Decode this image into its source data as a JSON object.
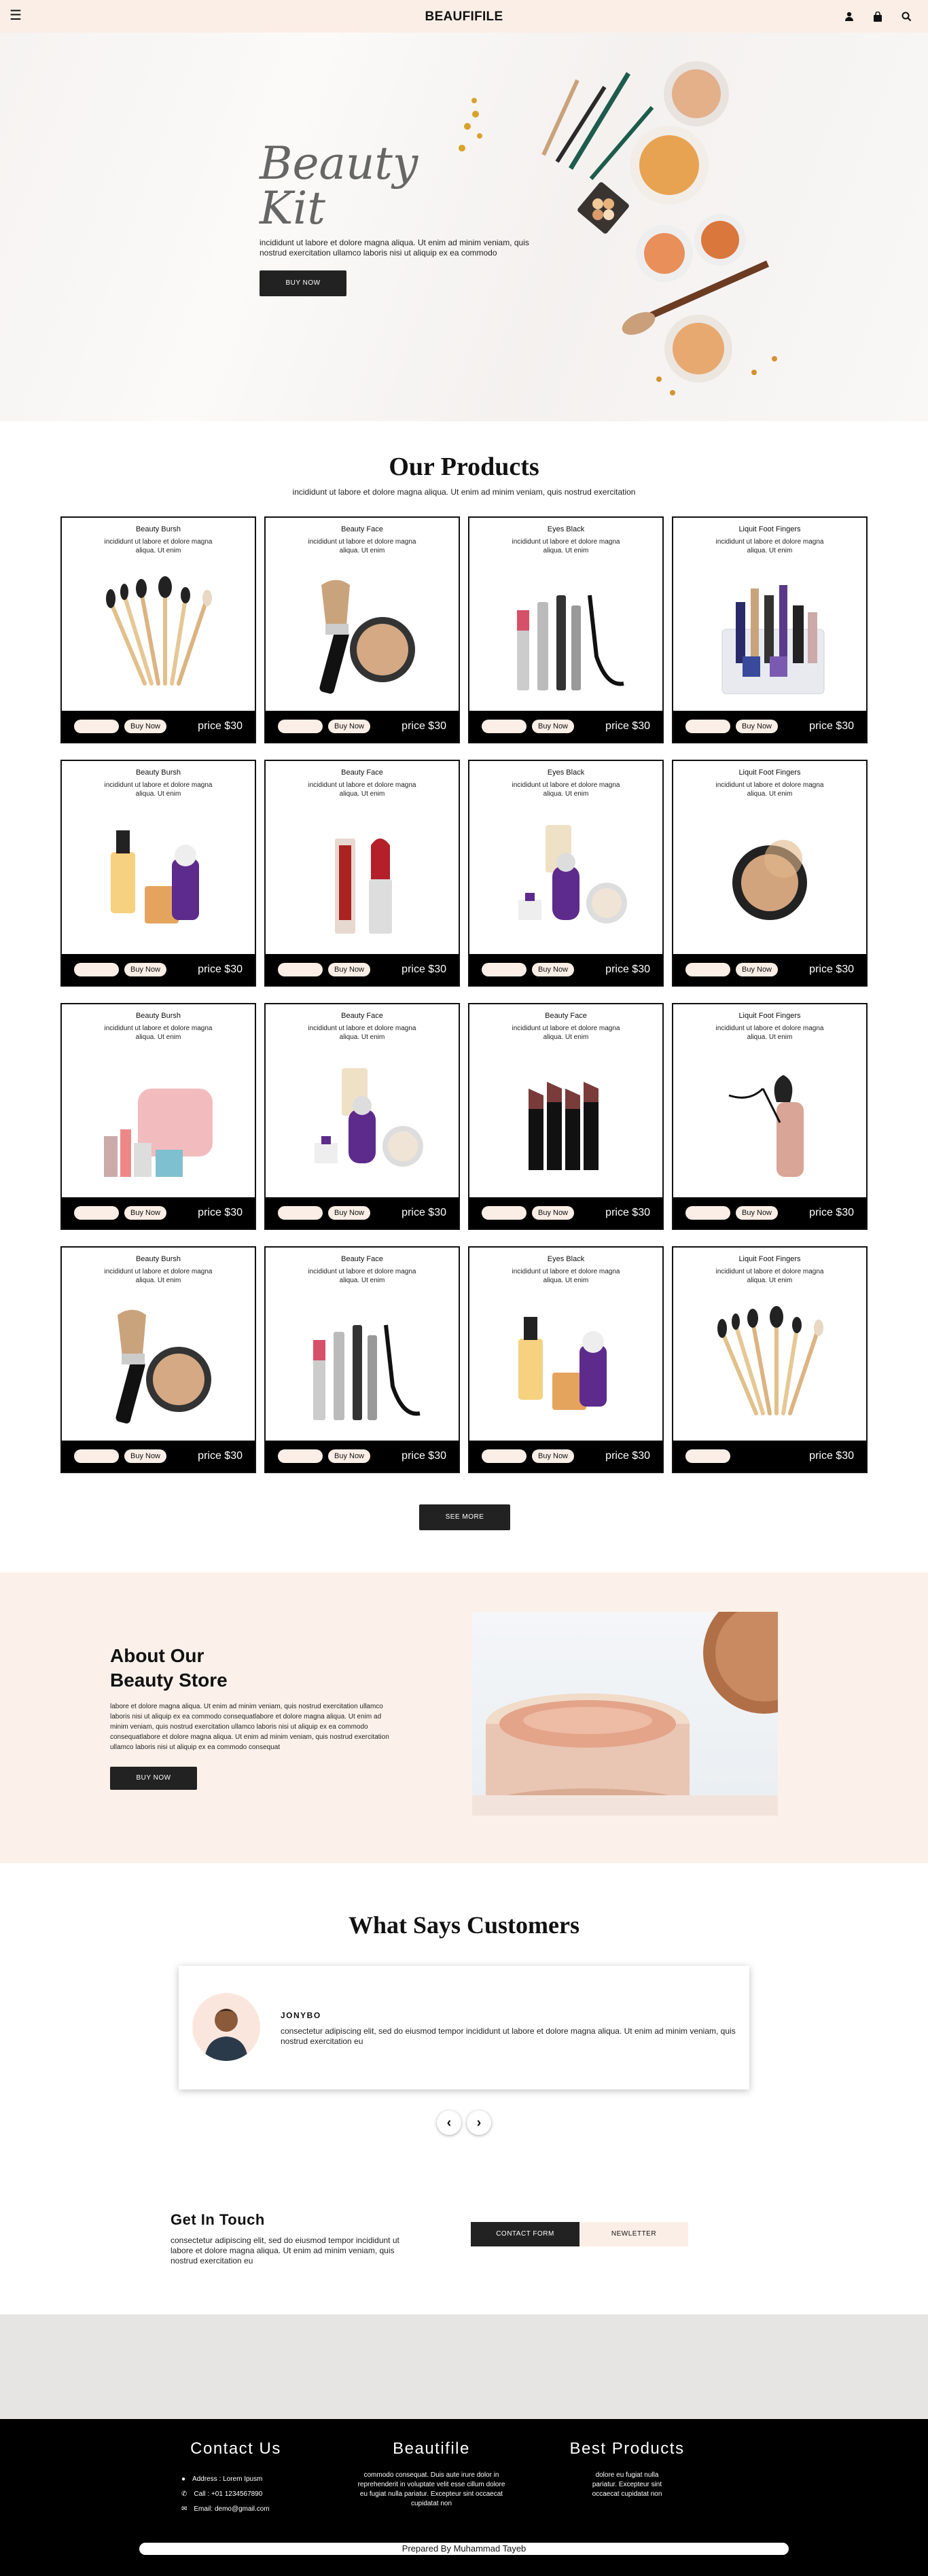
{
  "header": {
    "brand": "BEAUFIFILE",
    "icons": [
      "menu-icon",
      "user-icon",
      "bag-icon",
      "search-icon"
    ]
  },
  "hero": {
    "title": "Beauty\nKit",
    "text": "incididunt ut labore et dolore magna aliqua. Ut enim ad minim veniam, quis nostrud exercitation ullamco laboris nisi ut aliquip ex ea commodo",
    "button": "BUY NOW"
  },
  "products": {
    "heading": "Our Products",
    "subtitle": "incididunt ut labore et dolore magna aliqua. Ut enim ad minim veniam, quis nostrud exercitation",
    "buy_label": "Buy Now",
    "items": [
      {
        "name": "Beauty Bursh",
        "desc": "incididunt ut labore et dolore magna aliqua. Ut enim",
        "price": "price $30",
        "art": "brushes"
      },
      {
        "name": "Beauty Face",
        "desc": "incididunt ut labore et dolore magna aliqua. Ut enim",
        "price": "price $30",
        "art": "powder-brush"
      },
      {
        "name": "Eyes Black",
        "desc": "incididunt ut labore et dolore magna aliqua. Ut enim",
        "price": "price $30",
        "art": "mascara"
      },
      {
        "name": "Liquit Foot Fingers",
        "desc": "incididunt ut labore et dolore magna aliqua. Ut enim",
        "price": "price $30",
        "art": "organizer"
      },
      {
        "name": "Beauty Bursh",
        "desc": "incididunt ut labore et dolore magna aliqua. Ut enim",
        "price": "price $30",
        "art": "serum"
      },
      {
        "name": "Beauty Face",
        "desc": "incididunt ut labore et dolore magna aliqua. Ut enim",
        "price": "price $30",
        "art": "lipstick"
      },
      {
        "name": "Eyes Black",
        "desc": "incididunt ut labore et dolore magna aliqua. Ut enim",
        "price": "price $30",
        "art": "skincare-set"
      },
      {
        "name": "Liquit Foot Fingers",
        "desc": "incididunt ut labore et dolore magna aliqua. Ut enim",
        "price": "price $30",
        "art": "compact"
      },
      {
        "name": "Beauty Bursh",
        "desc": "incididunt ut labore et dolore magna aliqua. Ut enim",
        "price": "price $30",
        "art": "bag"
      },
      {
        "name": "Beauty Face",
        "desc": "incididunt ut labore et dolore magna aliqua. Ut enim",
        "price": "price $30",
        "art": "skincare-set"
      },
      {
        "name": "Beauty Face",
        "desc": "incididunt ut labore et dolore magna aliqua. Ut enim",
        "price": "price $30",
        "art": "lipsticks"
      },
      {
        "name": "Liquit Foot Fingers",
        "desc": "incididunt ut labore et dolore magna aliqua. Ut enim",
        "price": "price $30",
        "art": "eyeliner"
      },
      {
        "name": "Beauty Bursh",
        "desc": "incididunt ut labore et dolore magna aliqua. Ut enim",
        "price": "price $30",
        "art": "powder-brush"
      },
      {
        "name": "Beauty Face",
        "desc": "incididunt ut labore et dolore magna aliqua. Ut enim",
        "price": "price $30",
        "art": "mascara"
      },
      {
        "name": "Eyes Black",
        "desc": "incididunt ut labore et dolore magna aliqua. Ut enim",
        "price": "price $30",
        "art": "serum"
      },
      {
        "name": "Liquit Foot Fingers",
        "desc": "incididunt ut labore et dolore magna aliqua. Ut enim",
        "price": "price $30",
        "art": "brushes"
      }
    ],
    "see_more": "SEE MORE"
  },
  "about": {
    "heading": "About Our\nBeauty Store",
    "text": "labore et dolore magna aliqua. Ut enim ad minim veniam, quis nostrud exercitation ullamco laboris nisi ut aliquip ex ea commodo consequatlabore et dolore magna aliqua. Ut enim ad minim veniam, quis nostrud exercitation ullamco laboris nisi ut aliquip ex ea commodo consequatlabore et dolore magna aliqua. Ut enim ad minim veniam, quis nostrud exercitation ullamco laboris nisi ut aliquip ex ea commodo consequat",
    "button": "BUY NOW"
  },
  "customers": {
    "heading": "What Says Customers",
    "name": "JONYBO",
    "quote": "consectetur adipiscing elit, sed do eiusmod tempor incididunt ut labore et dolore magna aliqua. Ut enim ad minim veniam, quis nostrud exercitation eu",
    "prev": "‹",
    "next": "›"
  },
  "touch": {
    "heading": "Get In Touch",
    "text": "consectetur adipiscing elit, sed do eiusmod tempor incididunt ut labore et dolore magna aliqua. Ut enim ad minim veniam, quis nostrud exercitation eu",
    "tab_contact": "CONTACT FORM",
    "tab_news": "NEWLETTER"
  },
  "footer": {
    "contact_heading": "Contact Us",
    "address": "Address : Lorem Ipusm",
    "call": "Call : +01 1234567890",
    "email": "Email: demo@gmail.com",
    "brand_heading": "Beautifile",
    "brand_text": "commodo consequat. Duis aute irure dolor in reprehenderit in voluptate velit esse cillum dolore eu fugiat nulla pariatur. Excepteur sint occaecat cupidatat non",
    "best_heading": "Best Products",
    "best_text": "dolore eu fugiat nulla pariatur. Excepteur sint occaecat cupidatat non",
    "prepared": "Prepared By Muhammad Tayeb"
  },
  "colors": {
    "peach": "#fbeee6",
    "dark": "#222222",
    "black": "#000000"
  }
}
